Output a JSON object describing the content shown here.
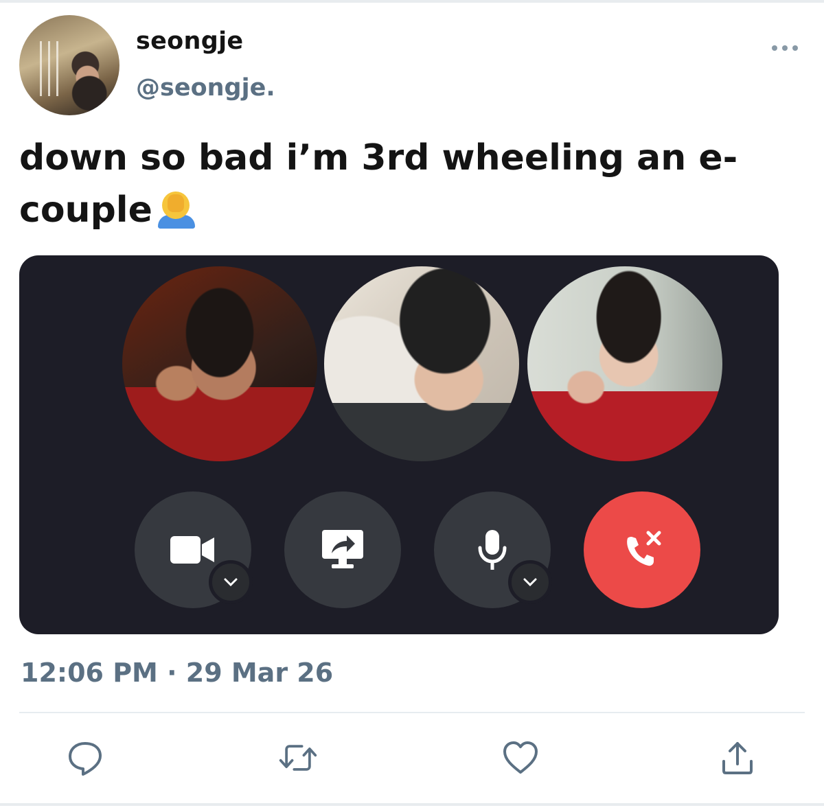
{
  "tweet": {
    "author": {
      "display_name": "seongje",
      "handle": "@seongje.",
      "avatar_icon": "profile-photo"
    },
    "text": "down so bad i’m 3rd wheeling an e-couple",
    "emoji": "face-palm",
    "timestamp": "12:06 PM · 29 Mar 26",
    "media": {
      "type": "voice-call-screenshot",
      "participants": [
        "participant-1",
        "participant-2",
        "participant-3"
      ],
      "controls": [
        "video-camera-icon",
        "screen-share-icon",
        "microphone-icon",
        "hang-up-icon"
      ],
      "end_call_color": "#ec4a48"
    },
    "actions": [
      "reply-icon",
      "retweet-icon",
      "like-icon",
      "share-icon"
    ]
  },
  "colors": {
    "secondary_text": "#5b7083",
    "call_background": "#1d1d27",
    "control_button": "#36393f"
  }
}
